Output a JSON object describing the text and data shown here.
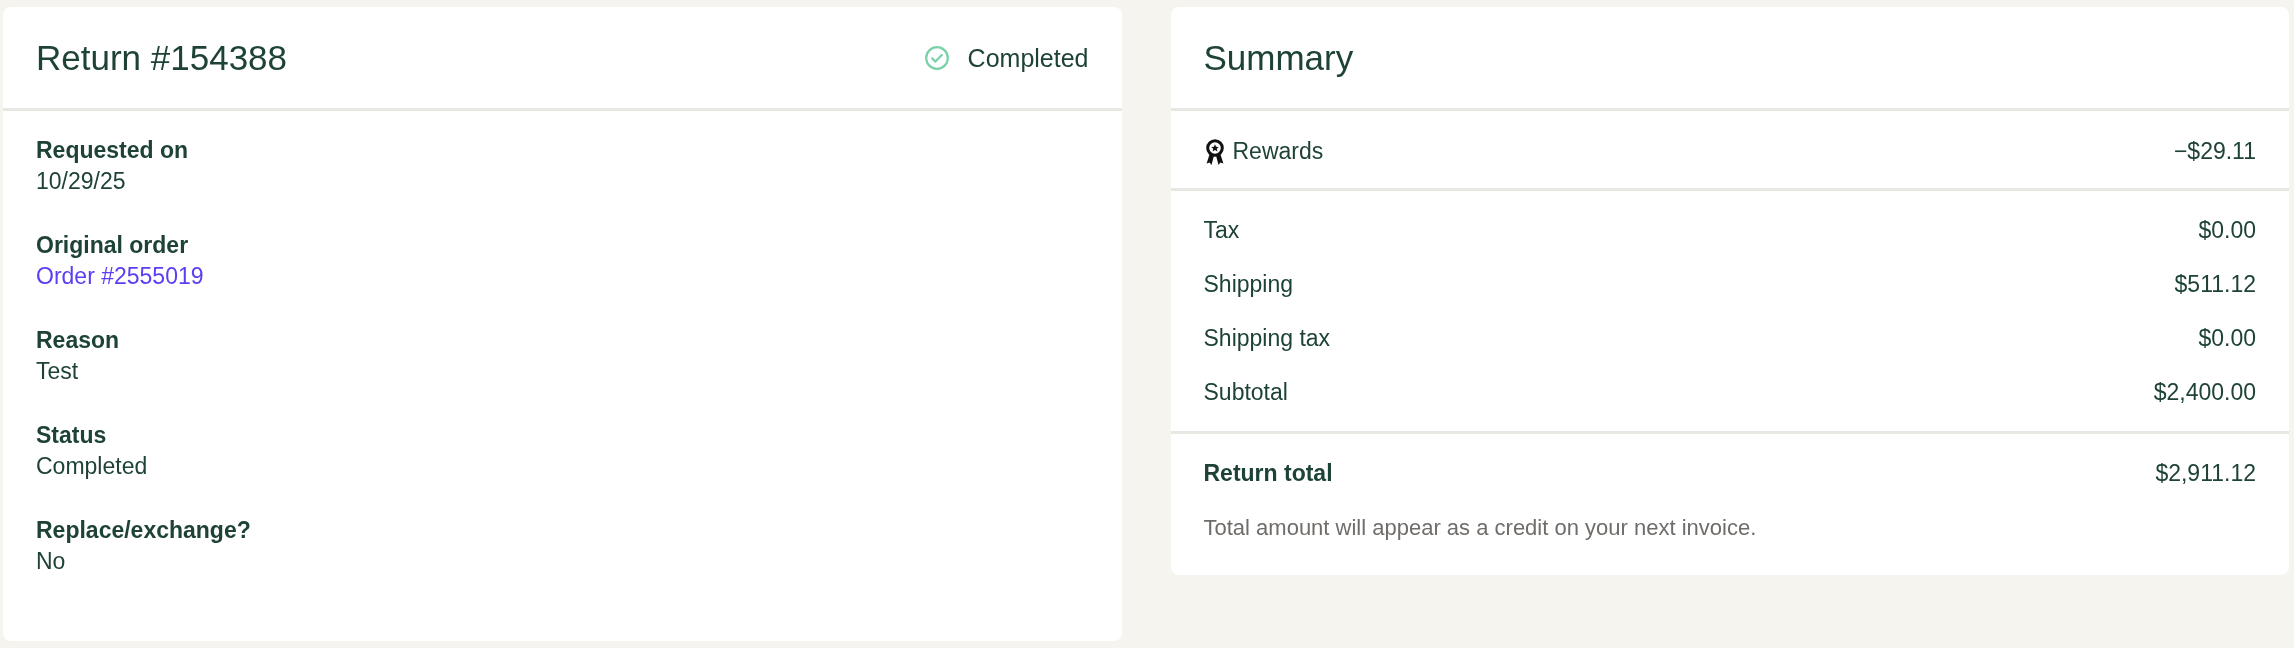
{
  "return_card": {
    "title": "Return #154388",
    "status": {
      "label": "Completed",
      "kind": "completed"
    },
    "fields": [
      {
        "label": "Requested on",
        "value": "10/29/25",
        "kind": "text"
      },
      {
        "label": "Original order",
        "value": "Order #2555019",
        "kind": "link"
      },
      {
        "label": "Reason",
        "value": "Test",
        "kind": "text"
      },
      {
        "label": "Status",
        "value": "Completed",
        "kind": "text"
      },
      {
        "label": "Replace/exchange?",
        "value": "No",
        "kind": "text"
      }
    ]
  },
  "summary_card": {
    "title": "Summary",
    "sections": [
      {
        "rows": [
          {
            "label": "Rewards",
            "value": "−$29.11",
            "kind": "reward"
          }
        ]
      },
      {
        "rows": [
          {
            "label": "Tax",
            "value": "$0.00",
            "kind": "plain"
          },
          {
            "label": "Shipping",
            "value": "$511.12",
            "kind": "plain"
          },
          {
            "label": "Shipping tax",
            "value": "$0.00",
            "kind": "plain"
          },
          {
            "label": "Subtotal",
            "value": "$2,400.00",
            "kind": "plain"
          }
        ]
      }
    ],
    "total": {
      "label": "Return total",
      "value": "$2,911.12"
    },
    "note": "Total amount will appear as a credit on your next invoice."
  }
}
